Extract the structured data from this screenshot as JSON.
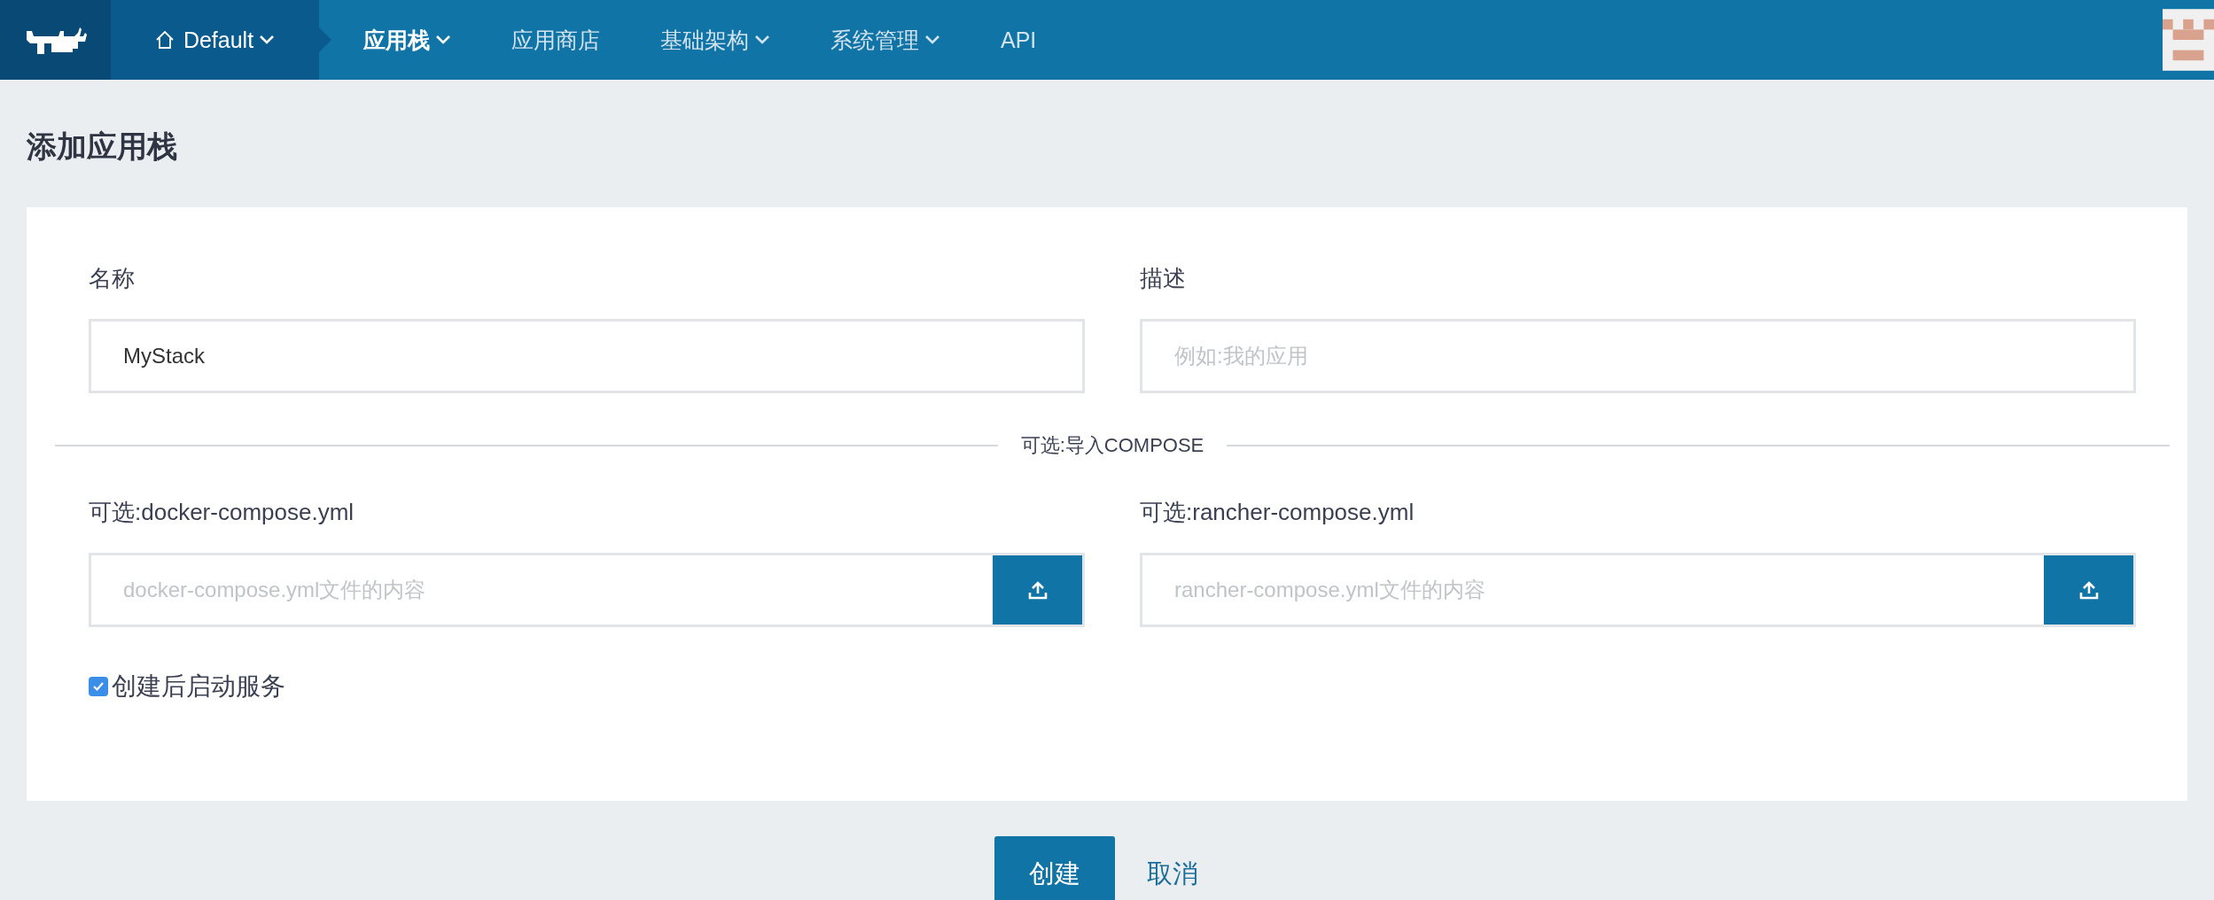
{
  "header": {
    "environment": {
      "label": "Default",
      "has_caret": true
    },
    "nav": [
      {
        "label": "应用栈",
        "selected": true,
        "has_caret": true
      },
      {
        "label": "应用商店",
        "selected": false,
        "has_caret": false
      },
      {
        "label": "基础架构",
        "selected": false,
        "has_caret": true
      },
      {
        "label": "系统管理",
        "selected": false,
        "has_caret": true
      },
      {
        "label": "API",
        "selected": false,
        "has_caret": false
      }
    ]
  },
  "page_title": "添加应用栈",
  "form": {
    "name": {
      "label": "名称",
      "value": "MyStack"
    },
    "description": {
      "label": "描述",
      "placeholder": "例如:我的应用"
    },
    "divider_label": "可选:导入COMPOSE",
    "compose_files": [
      {
        "label": "可选:docker-compose.yml",
        "placeholder": "docker-compose.yml文件的内容"
      },
      {
        "label": "可选:rancher-compose.yml",
        "placeholder": "rancher-compose.yml文件的内容"
      }
    ],
    "start_services": {
      "label": "创建后启动服务",
      "checked": true
    }
  },
  "actions": {
    "create": "创建",
    "cancel": "取消"
  }
}
